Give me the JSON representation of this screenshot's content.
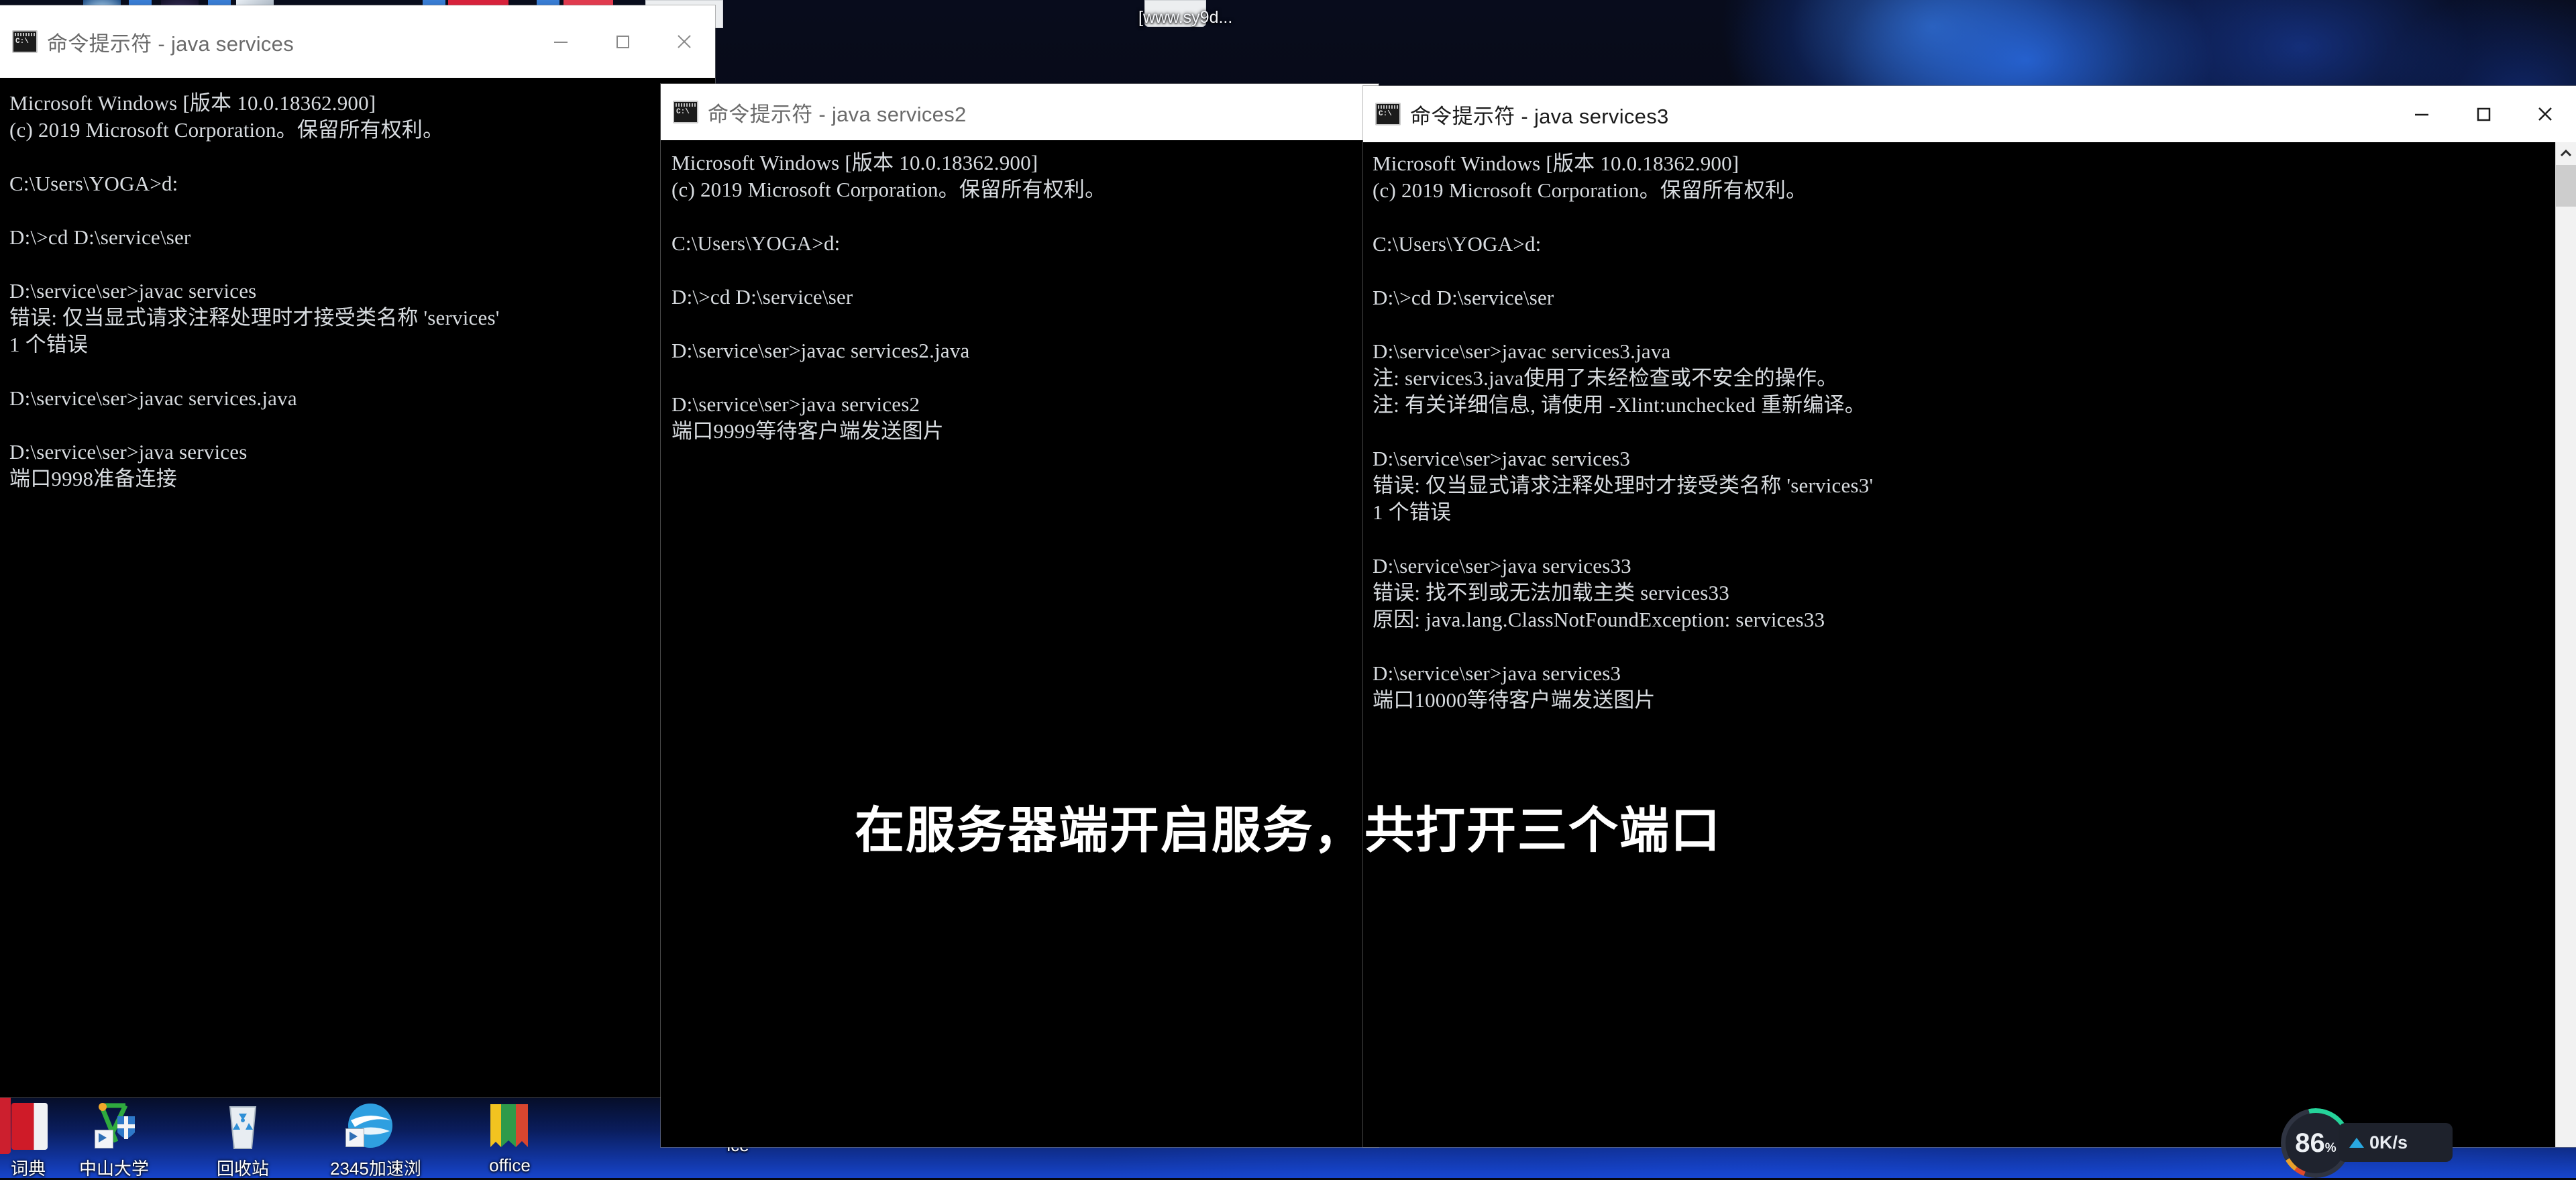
{
  "desktop": {
    "top_label": "[www.sy9d...",
    "icons": [
      {
        "name": "dictionary",
        "caption": "词典"
      },
      {
        "name": "sun-yat-sen",
        "caption": "中山大学"
      },
      {
        "name": "recycle-bin",
        "caption": "回收站"
      },
      {
        "name": "browser-2345",
        "caption": "2345加速浏"
      },
      {
        "name": "office",
        "caption": "office"
      },
      {
        "name": "ice",
        "caption": "ice"
      }
    ]
  },
  "windows": [
    {
      "id": "cmd-services",
      "title": "命令提示符 - java  services",
      "active": false,
      "controls": {
        "minimize": "—",
        "maximize": "□",
        "close": "✕"
      },
      "lines": [
        "Microsoft Windows [版本 10.0.18362.900]",
        "(c) 2019 Microsoft Corporation。保留所有权利。",
        "",
        "C:\\Users\\YOGA>d:",
        "",
        "D:\\>cd D:\\service\\ser",
        "",
        "D:\\service\\ser>javac services",
        "错误: 仅当显式请求注释处理时才接受类名称 'services'",
        "1 个错误",
        "",
        "D:\\service\\ser>javac services.java",
        "",
        "D:\\service\\ser>java services",
        "端口9998准备连接"
      ]
    },
    {
      "id": "cmd-services2",
      "title": "命令提示符 - java services2",
      "active": false,
      "controls": {
        "minimize": "—",
        "maximize": "□",
        "close": "✕"
      },
      "lines": [
        "Microsoft Windows [版本 10.0.18362.900]",
        "(c) 2019 Microsoft Corporation。保留所有权利。",
        "",
        "C:\\Users\\YOGA>d:",
        "",
        "D:\\>cd D:\\service\\ser",
        "",
        "D:\\service\\ser>javac services2.java",
        "",
        "D:\\service\\ser>java services2",
        "端口9999等待客户端发送图片"
      ]
    },
    {
      "id": "cmd-services3",
      "title": "命令提示符 - java services3",
      "active": true,
      "controls": {
        "minimize": "—",
        "maximize": "□",
        "close": "✕"
      },
      "lines": [
        "Microsoft Windows [版本 10.0.18362.900]",
        "(c) 2019 Microsoft Corporation。保留所有权利。",
        "",
        "C:\\Users\\YOGA>d:",
        "",
        "D:\\>cd D:\\service\\ser",
        "",
        "D:\\service\\ser>javac services3.java",
        "注: services3.java使用了未经检查或不安全的操作。",
        "注: 有关详细信息, 请使用 -Xlint:unchecked 重新编译。",
        "",
        "D:\\service\\ser>javac services3",
        "错误: 仅当显式请求注释处理时才接受类名称 'services3'",
        "1 个错误",
        "",
        "D:\\service\\ser>java services33",
        "错误: 找不到或无法加载主类 services33",
        "原因: java.lang.ClassNotFoundException: services33",
        "",
        "D:\\service\\ser>java services3",
        "端口10000等待客户端发送图片"
      ],
      "scrollbar": {
        "name": "vertical-scrollbar",
        "up_arrow": "∧"
      }
    }
  ],
  "subtitle": {
    "text": "在服务器端开启服务，共打开三个端口"
  },
  "sysmon": {
    "cpu_percent": "86",
    "cpu_unit": "%",
    "net_speed": "0K/s",
    "net_direction": "upload"
  }
}
